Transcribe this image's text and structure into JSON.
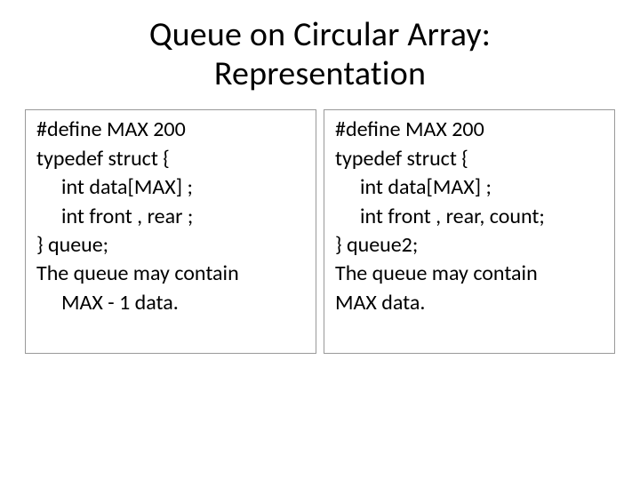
{
  "title_line1": "Queue on Circular Array:",
  "title_line2": "Representation",
  "left": {
    "l1": "#define MAX 200",
    "l2": "typedef struct {",
    "l3": "int data[MAX] ;",
    "l4": "int front , rear ;",
    "l5": "} queue;",
    "l6": "The queue may contain",
    "l7": "MAX - 1 data."
  },
  "right": {
    "l1": "#define MAX 200",
    "l2": "typedef struct {",
    "l3": "int data[MAX] ;",
    "l4": "int front , rear, count;",
    "l5": "} queue2;",
    "l6": "The queue may contain",
    "l7": "MAX  data."
  }
}
